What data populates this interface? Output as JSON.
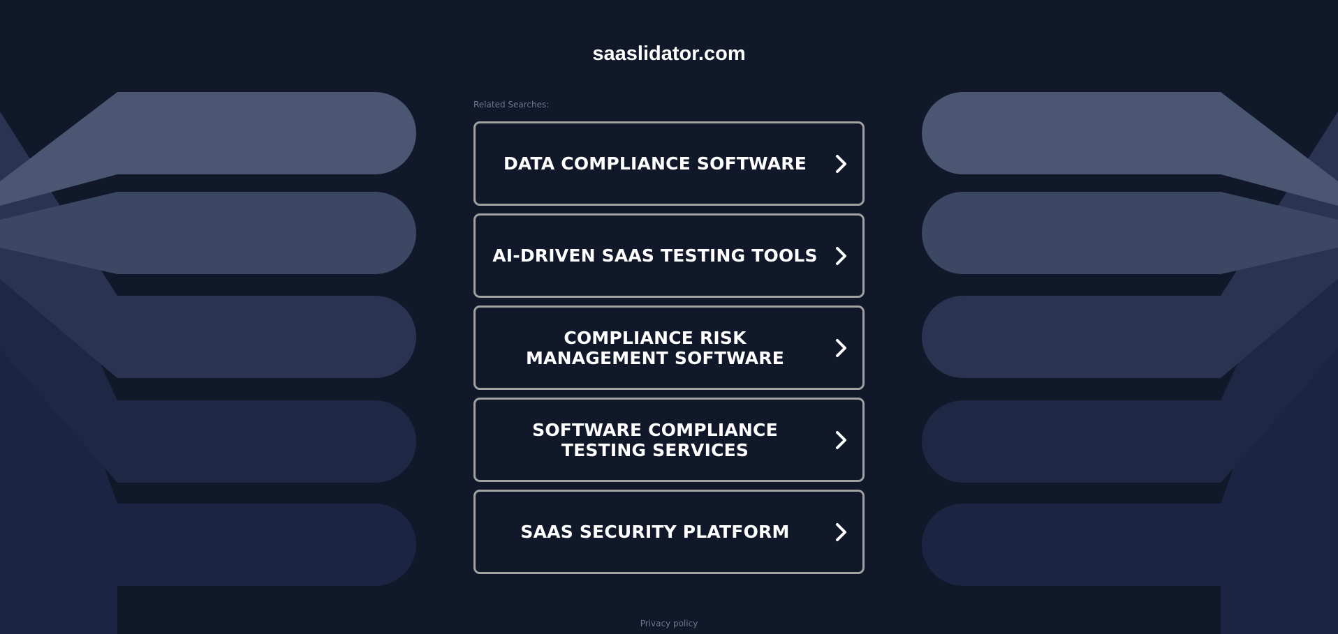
{
  "site": {
    "domain_title": "saaslidator.com",
    "related_label": "Related Searches:"
  },
  "links": [
    {
      "label": "DATA COMPLIANCE SOFTWARE"
    },
    {
      "label": "AI-DRIVEN SAAS TESTING TOOLS"
    },
    {
      "label": "COMPLIANCE RISK MANAGEMENT SOFTWARE"
    },
    {
      "label": "SOFTWARE COMPLIANCE TESTING SERVICES"
    },
    {
      "label": "SAAS SECURITY PLATFORM"
    }
  ],
  "footer": {
    "privacy_label": "Privacy policy"
  },
  "icons": {
    "link_arrow": "chevron-right-icon"
  },
  "colors": {
    "background": "#111829",
    "border": "#a2a2a2",
    "text": "#ffffff",
    "muted": "#6c7891",
    "shape_1": "#4b5673",
    "shape_2": "#3c4764",
    "shape_3": "#2a3452",
    "shape_4": "#1e2845",
    "shape_5": "#1b2442"
  }
}
